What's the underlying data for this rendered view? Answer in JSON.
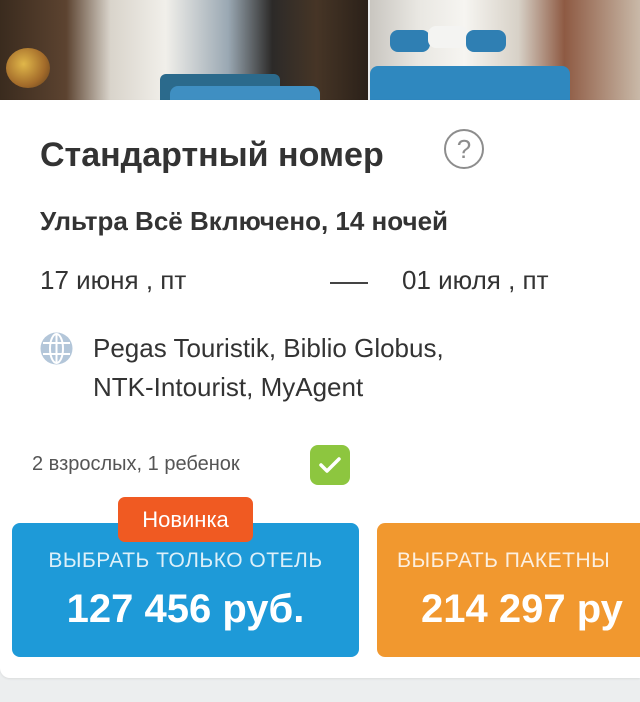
{
  "room": {
    "title": "Стандартный номер",
    "help_icon": "question-circle-icon",
    "board_and_nights": "Ультра Всё Включено, 14 ночей"
  },
  "dates": {
    "from": "17 июня , пт",
    "to": "01 июля , пт"
  },
  "operators": {
    "icon": "globe-icon",
    "line1": "Pegas Touristik, Biblio Globus,",
    "line2": "NTK-Intourist, MyAgent"
  },
  "guests": {
    "text": "2 взрослых, 1 ребенок",
    "checkbox_checked": true
  },
  "offers": {
    "hotel_only": {
      "badge": "Новинка",
      "caption": "ВЫБРАТЬ ТОЛЬКО ОТЕЛЬ",
      "price": "127 456 руб."
    },
    "package": {
      "caption": "ВЫБРАТЬ ПАКЕТНЫ",
      "price": "214 297 ру"
    }
  },
  "colors": {
    "hotel_button": "#1e9ad8",
    "package_button": "#f1982f",
    "badge": "#f05a22",
    "check": "#8dc63f"
  }
}
